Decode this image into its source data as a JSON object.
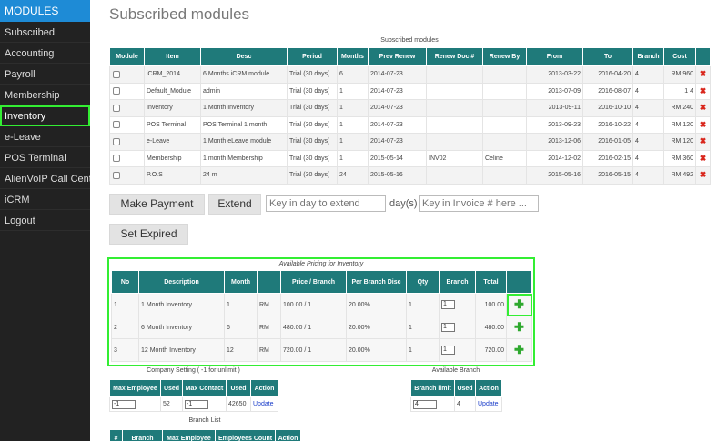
{
  "sidebar": {
    "header": "MODULES",
    "items": [
      "Subscribed",
      "Accounting",
      "Payroll",
      "Membership",
      "Inventory",
      "e-Leave",
      "POS Terminal",
      "AlienVoIP Call Center Ch",
      "iCRM",
      "Logout"
    ]
  },
  "page": {
    "title": "Subscribed modules"
  },
  "subscribed": {
    "caption": "Subscribed modules",
    "headers": [
      "Module",
      "Item",
      "Desc",
      "Period",
      "Months",
      "Prev Renew",
      "Renew Doc #",
      "Renew By",
      "From",
      "To",
      "Branch",
      "Cost",
      ""
    ],
    "rows": [
      [
        "",
        "iCRM_2014",
        "6 Months iCRM module",
        "Trial (30 days)",
        "6",
        "2014-07-23",
        "",
        "",
        "2013-03-22",
        "2016-04-20",
        "4",
        "RM 960"
      ],
      [
        "",
        "Default_Module",
        "admin",
        "Trial (30 days)",
        "1",
        "2014-07-23",
        "",
        "",
        "2013-07-09",
        "2016-08-07",
        "4",
        "1 4"
      ],
      [
        "",
        "Inventory",
        "1 Month Inventory",
        "Trial (30 days)",
        "1",
        "2014-07-23",
        "",
        "",
        "2013-09-11",
        "2016-10-10",
        "4",
        "RM 240"
      ],
      [
        "",
        "POS Terminal",
        "POS Terminal 1 month",
        "Trial (30 days)",
        "1",
        "2014-07-23",
        "",
        "",
        "2013-09-23",
        "2016-10-22",
        "4",
        "RM 120"
      ],
      [
        "",
        "e-Leave",
        "1 Month eLeave module",
        "Trial (30 days)",
        "1",
        "2014-07-23",
        "",
        "",
        "2013-12-06",
        "2016-01-05",
        "4",
        "RM 120"
      ],
      [
        "",
        "Membership",
        "1 month Membership",
        "Trial (30 days)",
        "1",
        "2015-05-14",
        "INV02",
        "Celine",
        "2014-12-02",
        "2016-02-15",
        "4",
        "RM 360"
      ],
      [
        "",
        "P.O.S",
        "24 m",
        "Trial (30 days)",
        "24",
        "2015-05-16",
        "",
        "",
        "2015-05-16",
        "2016-05-15",
        "4",
        "RM 492"
      ]
    ]
  },
  "actions": {
    "make_payment": "Make Payment",
    "extend": "Extend",
    "extend_placeholder": "Key in day to extend",
    "days_label": "day(s)",
    "invoice_placeholder": "Key in Invoice # here ...",
    "set_expired": "Set Expired"
  },
  "pricing": {
    "caption": "Available Pricing for Inventory",
    "headers": [
      "No",
      "Description",
      "Month",
      "",
      "Price / Branch",
      "Per Branch Disc",
      "Qty",
      "Branch",
      "Total",
      ""
    ],
    "rows": [
      [
        "1",
        "1 Month Inventory",
        "1",
        "RM",
        "100.00 / 1",
        "20.00%",
        "1",
        "1",
        "100.00"
      ],
      [
        "2",
        "6 Month Inventory",
        "6",
        "RM",
        "480.00 / 1",
        "20.00%",
        "1",
        "1",
        "480.00"
      ],
      [
        "3",
        "12 Month Inventory",
        "12",
        "RM",
        "720.00 / 1",
        "20.00%",
        "1",
        "1",
        "720.00"
      ]
    ]
  },
  "company": {
    "caption": "Company Setting ( -1 for unlimit )",
    "headers": [
      "Max Employee",
      "Used",
      "Max Contact",
      "Used",
      "Action"
    ],
    "row": [
      "-1",
      "52",
      "-1",
      "42650",
      "Update"
    ]
  },
  "branch": {
    "caption": "Available Branch",
    "headers": [
      "Branch limit",
      "Used",
      "Action"
    ],
    "row": [
      "4",
      "4",
      "Update"
    ]
  },
  "branch_list": {
    "caption": "Branch List",
    "headers": [
      "#",
      "Branch",
      "Max Employee",
      "Employees Count",
      "Action"
    ]
  },
  "colors": {
    "accent": "#1e8bd6",
    "table_header": "#1f7a7a",
    "highlight": "#33ee33",
    "delete": "#d9261c",
    "add": "#2ea82e"
  }
}
